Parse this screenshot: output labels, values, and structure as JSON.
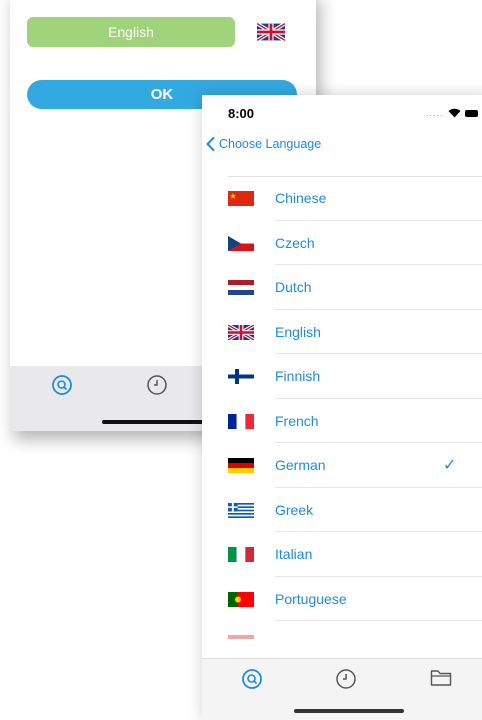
{
  "back_screen": {
    "selected_language": "English",
    "ok_label": "OK"
  },
  "front_screen": {
    "status_time": "8:00",
    "status_dots": ".....",
    "nav_back_label": "Choose Language",
    "languages": [
      {
        "name": "Chinese",
        "flag": "china-flag-icon",
        "checked": false
      },
      {
        "name": "Czech",
        "flag": "czech-flag-icon",
        "checked": false
      },
      {
        "name": "Dutch",
        "flag": "netherlands-flag-icon",
        "checked": false
      },
      {
        "name": "English",
        "flag": "uk-flag-icon",
        "checked": false
      },
      {
        "name": "Finnish",
        "flag": "finland-flag-icon",
        "checked": false
      },
      {
        "name": "French",
        "flag": "france-flag-icon",
        "checked": false
      },
      {
        "name": "German",
        "flag": "germany-flag-icon",
        "checked": true
      },
      {
        "name": "Greek",
        "flag": "greece-flag-icon",
        "checked": false
      },
      {
        "name": "Italian",
        "flag": "italy-flag-icon",
        "checked": false
      },
      {
        "name": "Portuguese",
        "flag": "portugal-flag-icon",
        "checked": false
      }
    ],
    "check_mark": "✓"
  },
  "colors": {
    "accent": "#1f8cd9",
    "selected_pill": "#9fd37c",
    "ok_button": "#33a9e1"
  },
  "tab_icons": [
    "search-icon",
    "history-icon",
    "folder-icon"
  ]
}
